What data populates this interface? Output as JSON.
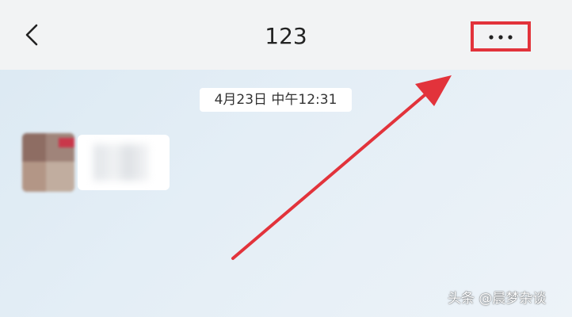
{
  "header": {
    "title": "123",
    "back_icon": "chevron-left-icon",
    "more_icon": "more-dots-icon"
  },
  "chat": {
    "timestamp": "4月23日 中午12:31"
  },
  "annotation": {
    "color": "#e2333b"
  },
  "watermark": {
    "text": "头条 @晨梦杂谈"
  }
}
